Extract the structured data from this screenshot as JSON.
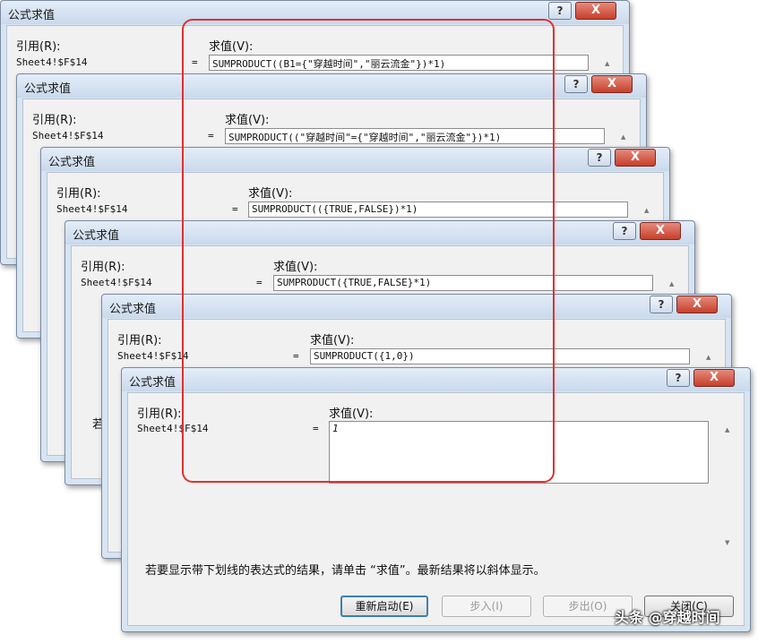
{
  "dialog_title": "公式求值",
  "reference_label": "引用(R):",
  "evaluation_label": "求值(V):",
  "reference_value": "Sheet4!$F$14",
  "equals": "=",
  "help_glyph": "?",
  "close_glyph": "X",
  "expressions": {
    "d1": "SUMPRODUCT((B1={\"穿越时间\",\"丽云流金\"})*1)",
    "d2": "SUMPRODUCT((\"穿越时间\"={\"穿越时间\",\"丽云流金\"})*1)",
    "d3": "SUMPRODUCT(({TRUE,FALSE})*1)",
    "d4": "SUMPRODUCT({TRUE,FALSE}*1)",
    "d5": "SUMPRODUCT({1,0})",
    "d6": "1"
  },
  "status_text": "若要显示带下划线的表达式的结果，请单击 “求值”。最新结果将以斜体显示。",
  "partial_text": "若",
  "buttons": {
    "restart": "重新启动(E)",
    "step_in": "步入(I)",
    "step_out": "步出(O)",
    "close": "关闭(C)"
  },
  "watermark": "头条 @穿越时间"
}
